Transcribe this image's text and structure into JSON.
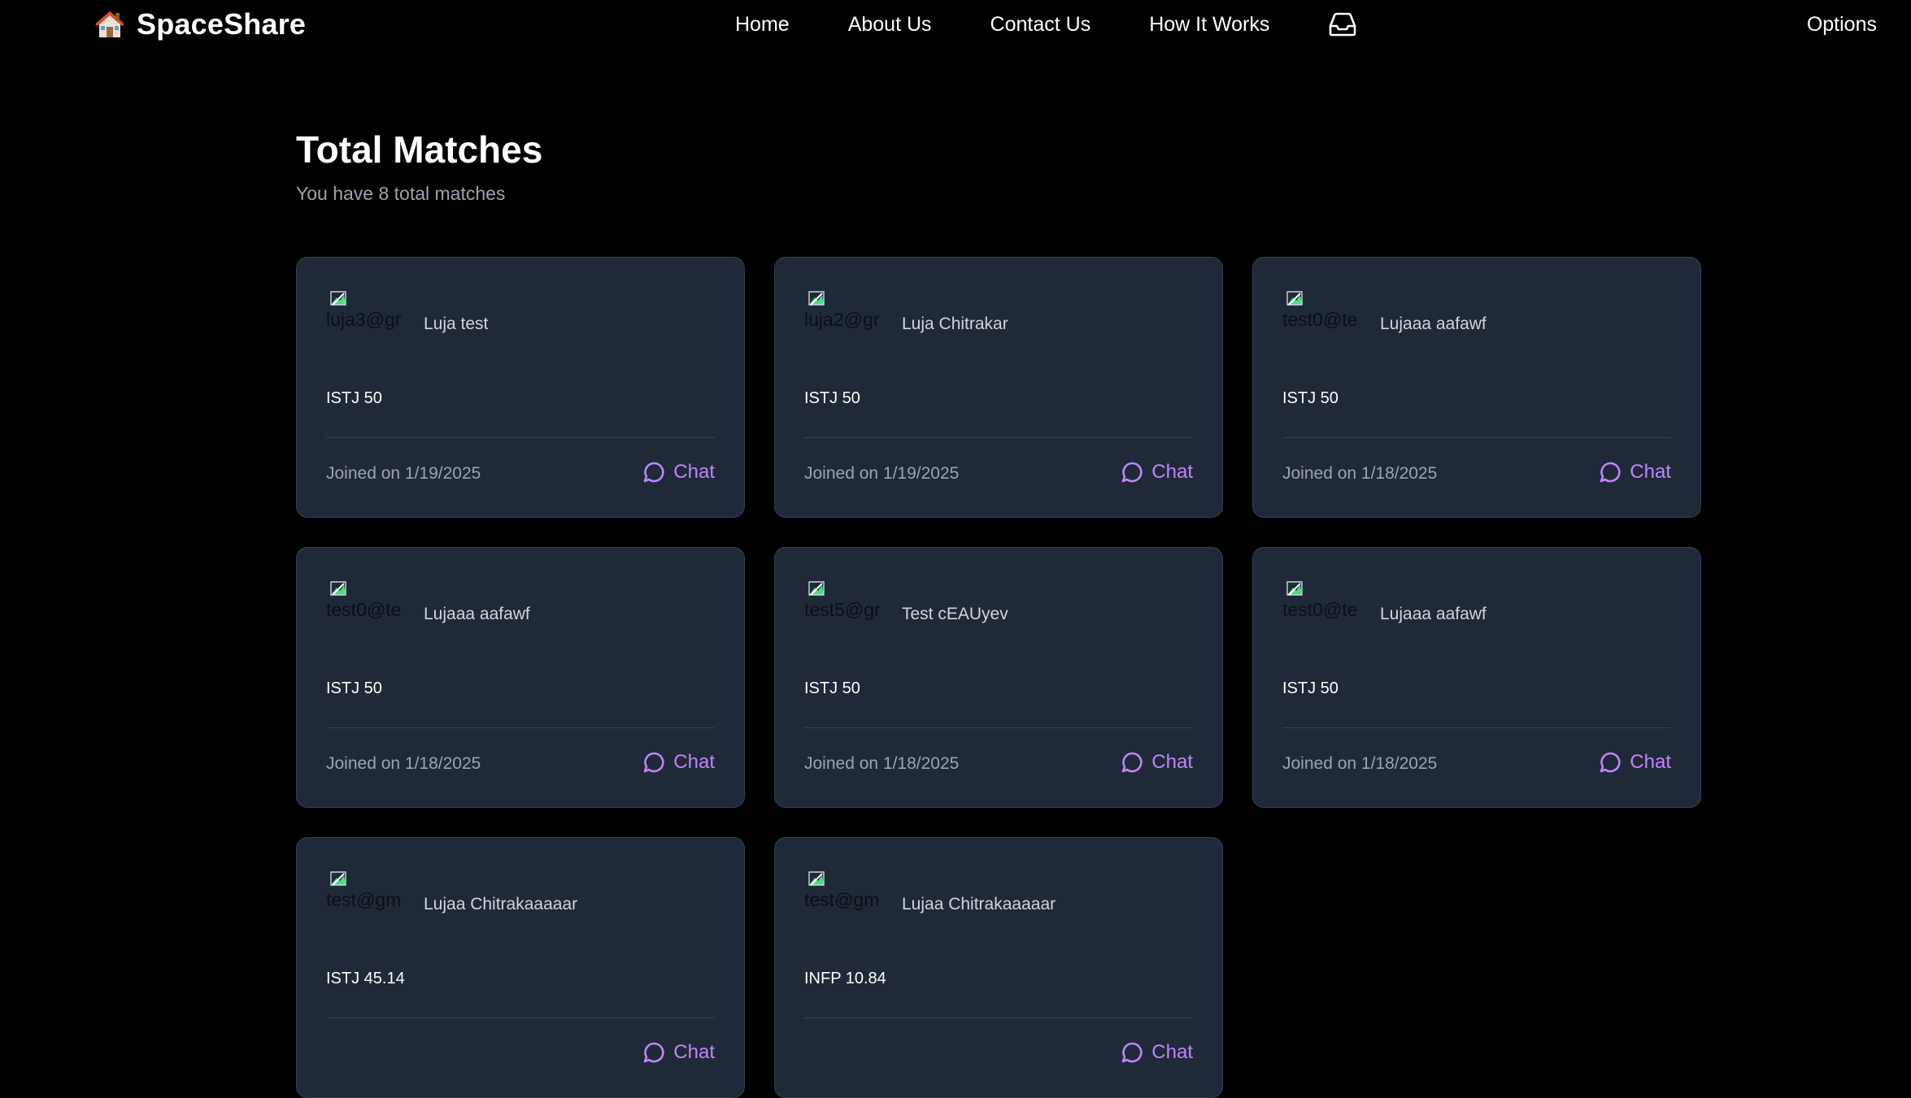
{
  "nav": {
    "brand": "SpaceShare",
    "links": [
      "Home",
      "About Us",
      "Contact Us",
      "How It Works"
    ],
    "inbox_icon": "inbox-icon",
    "options": "Options"
  },
  "page": {
    "title": "Total Matches",
    "subtitle": "You have 8 total matches"
  },
  "matches": [
    {
      "avatar_alt": "luja3@gr",
      "name": "Luja test",
      "mbti": "ISTJ 50",
      "joined": "Joined on 1/19/2025",
      "chat": "Chat"
    },
    {
      "avatar_alt": "luja2@gr",
      "name": "Luja Chitrakar",
      "mbti": "ISTJ 50",
      "joined": "Joined on 1/19/2025",
      "chat": "Chat"
    },
    {
      "avatar_alt": "test0@te",
      "name": "Lujaaa aafawf",
      "mbti": "ISTJ 50",
      "joined": "Joined on 1/18/2025",
      "chat": "Chat"
    },
    {
      "avatar_alt": "test0@te",
      "name": "Lujaaa aafawf",
      "mbti": "ISTJ 50",
      "joined": "Joined on 1/18/2025",
      "chat": "Chat"
    },
    {
      "avatar_alt": "test5@gr",
      "name": "Test cEAUyev",
      "mbti": "ISTJ 50",
      "joined": "Joined on 1/18/2025",
      "chat": "Chat"
    },
    {
      "avatar_alt": "test0@te",
      "name": "Lujaaa aafawf",
      "mbti": "ISTJ 50",
      "joined": "Joined on 1/18/2025",
      "chat": "Chat"
    },
    {
      "avatar_alt": "test@gm",
      "name": "Lujaa Chitrakaaaaar",
      "mbti": "ISTJ 45.14",
      "joined": "",
      "chat": "Chat"
    },
    {
      "avatar_alt": "test@gm",
      "name": "Lujaa Chitrakaaaaar",
      "mbti": "INFP 10.84",
      "joined": "",
      "chat": "Chat"
    }
  ],
  "colors": {
    "background": "#000000",
    "card": "#1f2937",
    "card_border": "#374151",
    "accent": "#c084fc",
    "muted": "#9ca3af"
  }
}
